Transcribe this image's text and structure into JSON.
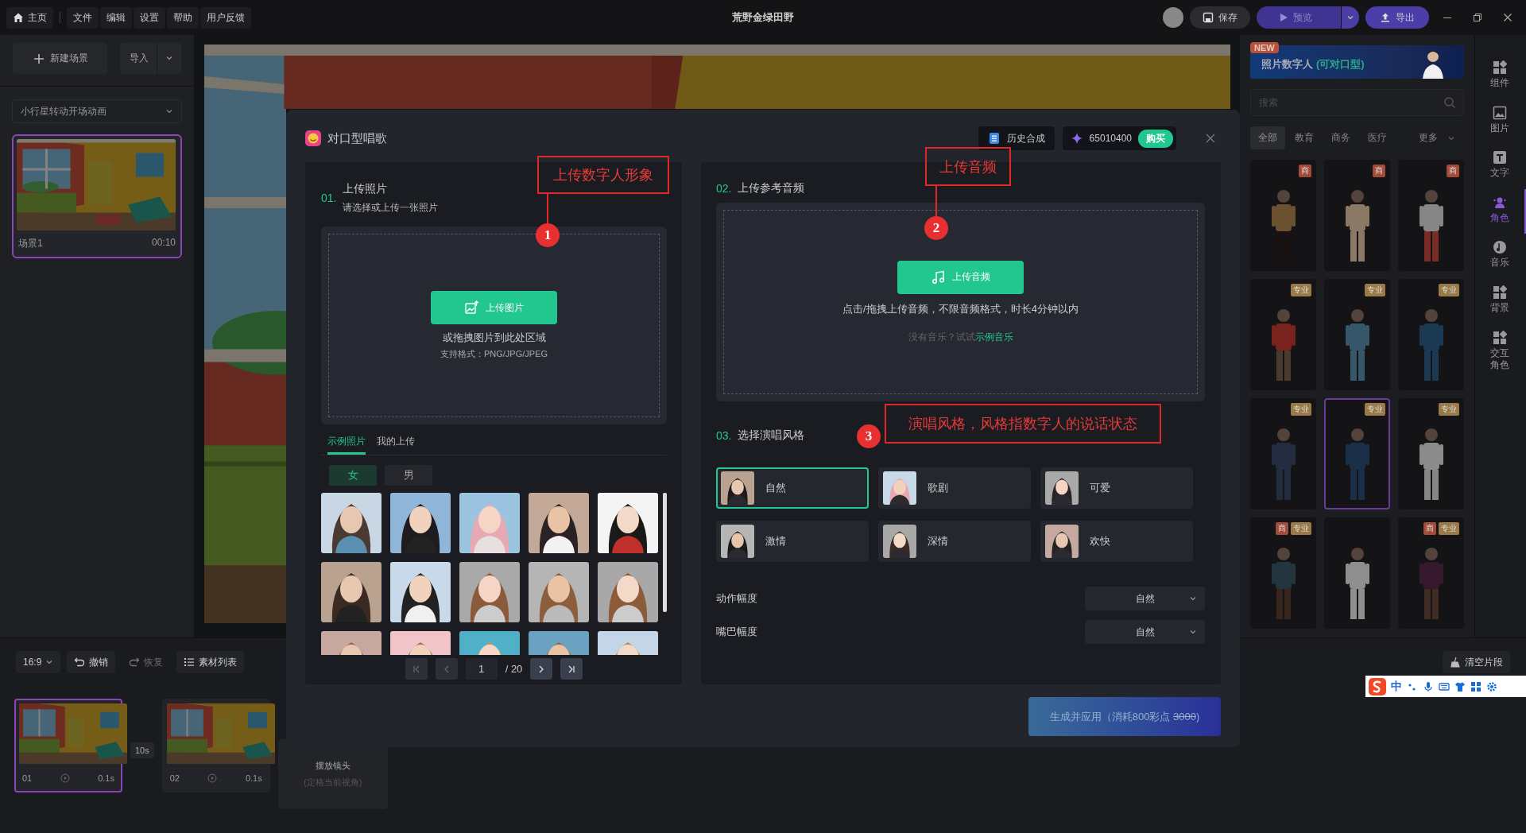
{
  "topbar": {
    "home": "主页",
    "menus": [
      "文件",
      "编辑",
      "设置",
      "帮助",
      "用户反馈"
    ],
    "title": "荒野金绿田野",
    "save": "保存",
    "preview": "预览",
    "export": "导出"
  },
  "left_panel": {
    "new_scene": "新建场景",
    "import": "导入",
    "project": "小行星转动开场动画",
    "scenes": [
      {
        "name": "场景1",
        "duration": "00:10",
        "selected": true
      }
    ]
  },
  "modal": {
    "title": "对口型唱歌",
    "history": "历史合成",
    "points": "65010400",
    "buy": "购买",
    "photo_section": {
      "number": "01.",
      "title": "上传照片",
      "subtitle": "请选择或上传一张照片",
      "upload_button": "上传图片",
      "hint": "或拖拽图片到此处区域",
      "formats": "支持格式：PNG/JPG/JPEG",
      "tabs": [
        {
          "label": "示例照片",
          "selected": true
        },
        {
          "label": "我的上传",
          "selected": false
        }
      ],
      "genders": [
        {
          "label": "女",
          "selected": true
        },
        {
          "label": "男",
          "selected": false
        }
      ],
      "pagination": {
        "page": "1",
        "total": "/ 20",
        "back_disabled": true,
        "forward_disabled": false
      }
    },
    "audio_section": {
      "number": "02.",
      "title": "上传参考音频",
      "upload_button": "上传音频",
      "hint": "点击/拖拽上传音频，不限音频格式，时长4分钟以内",
      "try_prefix": "没有音乐？试试",
      "try_link": "示例音乐"
    },
    "style_section": {
      "number": "03.",
      "title": "选择演唱风格",
      "styles": [
        {
          "label": "自然",
          "selected": true
        },
        {
          "label": "歌剧",
          "selected": false
        },
        {
          "label": "可爱",
          "selected": false
        },
        {
          "label": "激情",
          "selected": false
        },
        {
          "label": "深情",
          "selected": false
        },
        {
          "label": "欢快",
          "selected": false
        }
      ]
    },
    "settings": [
      {
        "label": "动作幅度",
        "value": "自然"
      },
      {
        "label": "嘴巴幅度",
        "value": "自然"
      }
    ],
    "generate": {
      "label": "生成并应用（消耗800彩点",
      "old_price": "3000",
      "suffix": ")"
    },
    "annotations": [
      {
        "label": "上传数字人形象",
        "number": "1"
      },
      {
        "label": "上传音频",
        "number": "2"
      },
      {
        "label": "演唱风格，风格指数字人的说话状态",
        "number": "3"
      }
    ]
  },
  "right_panel": {
    "banner": {
      "badge": "NEW",
      "title": "照片数字人",
      "highlight": "(可对口型)"
    },
    "search": {
      "placeholder": "搜索"
    },
    "categories": [
      {
        "label": "全部",
        "selected": true
      },
      {
        "label": "教育",
        "selected": false
      },
      {
        "label": "商务",
        "selected": false
      },
      {
        "label": "医疗",
        "selected": false
      },
      {
        "label": "更多",
        "selected": false
      }
    ],
    "characters": [
      {
        "selected": false,
        "badges": [
          {
            "label": "商",
            "color": "#a34a38"
          }
        ]
      },
      {
        "selected": false,
        "badges": [
          {
            "label": "商",
            "color": "#a34a38"
          }
        ]
      },
      {
        "selected": false,
        "badges": [
          {
            "label": "商",
            "color": "#a34a38"
          }
        ]
      },
      {
        "selected": false,
        "badges": [
          {
            "label": "专业",
            "color": "#9a7a48"
          }
        ]
      },
      {
        "selected": false,
        "badges": [
          {
            "label": "专业",
            "color": "#9a7a48"
          }
        ]
      },
      {
        "selected": false,
        "badges": [
          {
            "label": "专业",
            "color": "#9a7a48"
          }
        ]
      },
      {
        "selected": false,
        "badges": [
          {
            "label": "专业",
            "color": "#9a7a48"
          }
        ]
      },
      {
        "selected": true,
        "badges": [
          {
            "label": "专业",
            "color": "#9a7a48"
          }
        ]
      },
      {
        "selected": false,
        "badges": [
          {
            "label": "专业",
            "color": "#9a7a48"
          }
        ]
      },
      {
        "selected": false,
        "badges": [
          {
            "label": "商",
            "color": "#a34a38"
          },
          {
            "label": "专业",
            "color": "#9a7a48"
          }
        ]
      },
      {
        "selected": false
      },
      {
        "selected": false,
        "badges": [
          {
            "label": "商",
            "color": "#a34a38"
          },
          {
            "label": "专业",
            "color": "#9a7a48"
          }
        ]
      }
    ]
  },
  "rail": [
    {
      "label": "组件",
      "selected": false
    },
    {
      "label": "图片",
      "selected": false
    },
    {
      "label": "文字",
      "selected": false
    },
    {
      "label": "角色",
      "selected": true
    },
    {
      "label": "音乐",
      "selected": false
    },
    {
      "label": "背景",
      "selected": false
    },
    {
      "label": "交互角色",
      "selected": false
    }
  ],
  "timeline": {
    "ratio": "16:9",
    "undo": "撤销",
    "redo": {
      "label": "恢复",
      "disabled": true
    },
    "materials": "素材列表",
    "clear": "清空片段",
    "clips": [
      {
        "index": "01",
        "duration": "0.1s",
        "selected": true
      },
      {
        "index": "02",
        "duration": "0.1s",
        "selected": false
      }
    ],
    "transition": "10s",
    "placeholder": {
      "title": "摆放镜头",
      "subtitle": "(定格当前视角)"
    }
  },
  "ime": {
    "mode": "中"
  }
}
